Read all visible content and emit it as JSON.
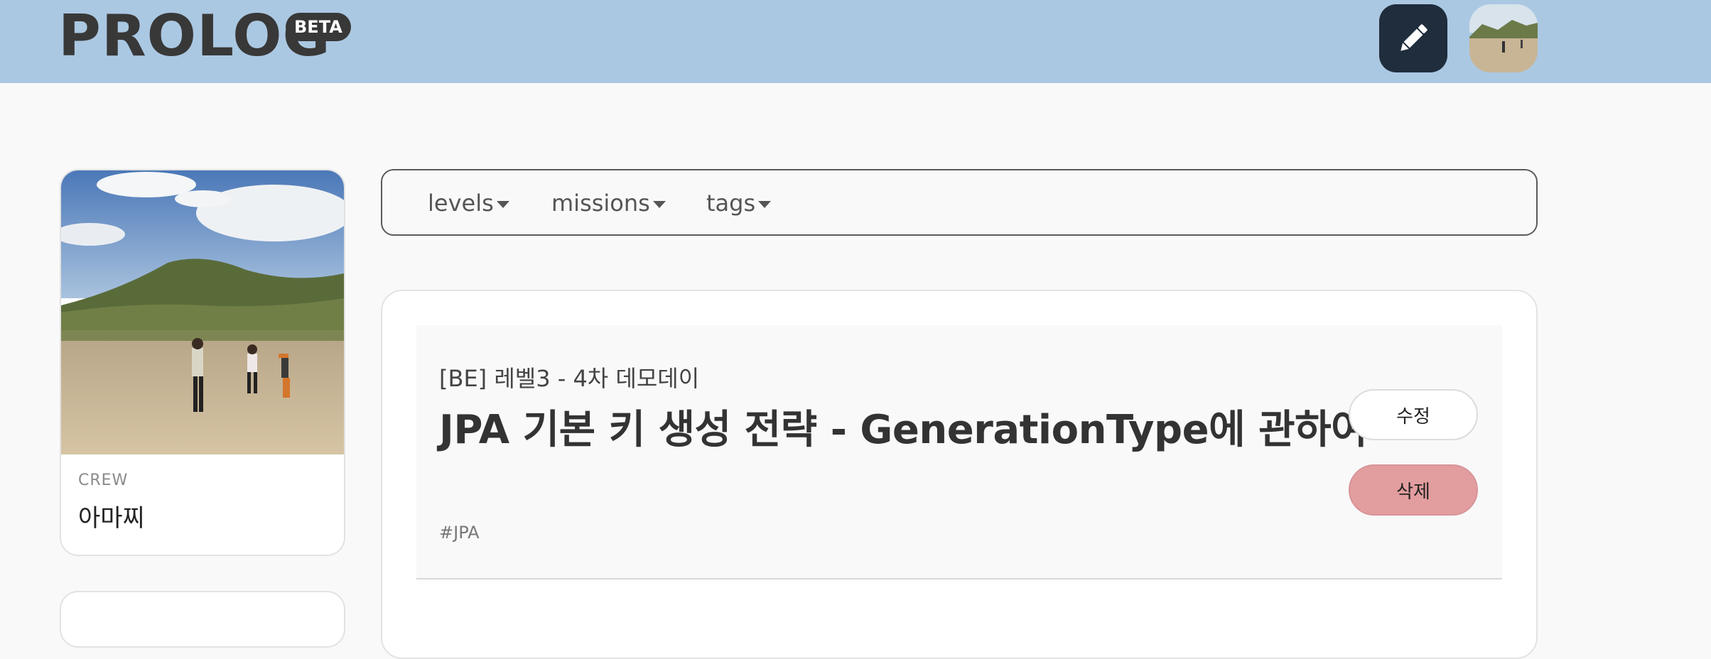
{
  "header": {
    "logo": "PROLOG",
    "beta_badge": "BETA",
    "write_icon": "pencil-icon",
    "avatar_icon": "user-avatar"
  },
  "profile": {
    "role": "CREW",
    "nickname": "아마찌"
  },
  "filters": [
    {
      "label": "levels",
      "icon": "caret-down-icon"
    },
    {
      "label": "missions",
      "icon": "caret-down-icon"
    },
    {
      "label": "tags",
      "icon": "caret-down-icon"
    }
  ],
  "post": {
    "mission": "[BE] 레벨3 - 4차 데모데이",
    "title": "JPA 기본 키 생성 전략 - GenerationType에 관하여",
    "tag": "#JPA",
    "edit_label": "수정",
    "delete_label": "삭제"
  },
  "colors": {
    "header_bg": "#abc8e2",
    "write_button_bg": "#1f2d3d",
    "delete_button_bg": "#e29d9f",
    "page_bg": "#f9f9f9"
  }
}
